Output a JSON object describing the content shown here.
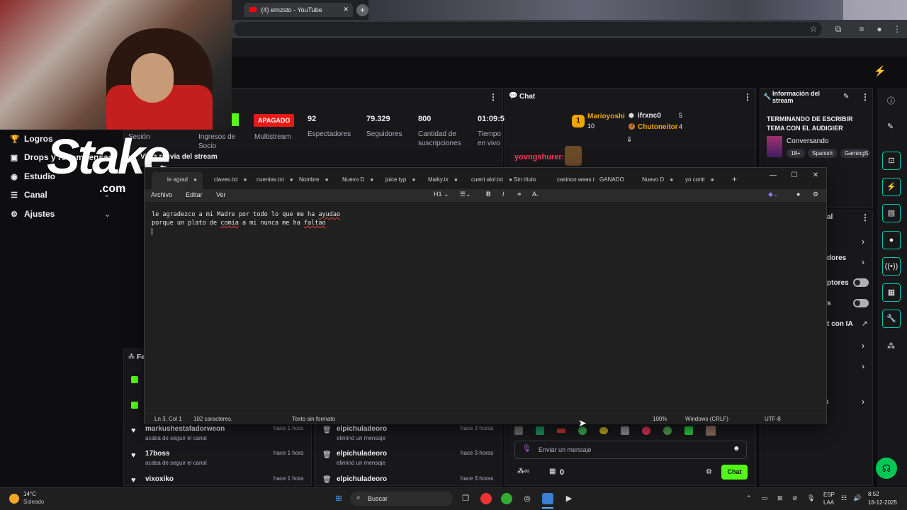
{
  "browser": {
    "tabs": [
      {
        "label": "(4) ernzsto - YouTube"
      }
    ],
    "new_tab": "+"
  },
  "nav": {
    "items": [
      {
        "label": "Logros",
        "icon": "trophy-icon"
      },
      {
        "label": "Drops y recompensas",
        "icon": "gift-icon"
      },
      {
        "label": "Estudio",
        "icon": "camera-icon"
      },
      {
        "label": "Canal",
        "icon": "list-icon"
      },
      {
        "label": "Ajustes",
        "icon": "gear-icon"
      }
    ],
    "stake": {
      "logo": "Stake",
      "suffix": ".com"
    }
  },
  "stats": {
    "cells": [
      {
        "value": "",
        "label": "Sesión"
      },
      {
        "value": "",
        "label": "Ingresos de Socio"
      },
      {
        "value": "APAGADO",
        "label": "Multistream"
      },
      {
        "value": "92",
        "label": "Espectadores"
      },
      {
        "value": "79.329",
        "label": "Seguidores"
      },
      {
        "value": "800",
        "label": "Cantidad de suscripciones"
      },
      {
        "value": "01:09:5",
        "label": "Tiempo en vivo"
      }
    ],
    "preview_title": "Vista previa del stream"
  },
  "chat": {
    "title": "Chat",
    "leaderboard": [
      {
        "rank": "1",
        "name": "Marioyoshi",
        "count": "10"
      },
      {
        "rank": "",
        "name": "ifrxnc0",
        "count": "5"
      },
      {
        "rank": "3",
        "name": "Chutoneitor",
        "count": "4"
      }
    ],
    "message_user": "yovngshurer:",
    "input_placeholder": "Enviar un mensaje",
    "points": "0",
    "send_label": "Chat"
  },
  "stream_info": {
    "title": "Información del stream",
    "stream_title": "TERMINANDO DE ESCRIBIR TEMA CON EL AUDIGIER",
    "category": "Conversando",
    "tags": [
      "18+",
      "Spanish",
      "GamingS"
    ]
  },
  "quick_actions": {
    "title": "al",
    "items": [
      {
        "label": "",
        "type": "link"
      },
      {
        "label": "dores",
        "type": "link"
      },
      {
        "label": "ptores",
        "type": "toggle"
      },
      {
        "label": "s",
        "type": "toggle"
      },
      {
        "label": "t con IA",
        "type": "external"
      },
      {
        "label": "",
        "type": "link"
      },
      {
        "label": "",
        "type": "link"
      },
      {
        "label": "s",
        "type": "link"
      }
    ]
  },
  "feed": {
    "title": "Fe",
    "left": [
      {
        "name": "markushestafadorweon",
        "sub": "acaba de seguir el canal",
        "time": "hace 1 hora"
      },
      {
        "name": "17boss",
        "sub": "acaba de seguir el canal",
        "time": "hace 1 hora"
      },
      {
        "name": "vixoxiko",
        "sub": "",
        "time": "hace 1 hora"
      }
    ],
    "right": [
      {
        "name": "elpichuladeoro",
        "sub": "eliminó un mensaje",
        "time": "hace 3 horas"
      },
      {
        "name": "elpichuladeoro",
        "sub": "eliminó un mensaje",
        "time": "hace 3 horas"
      },
      {
        "name": "elpichuladeoro",
        "sub": "",
        "time": "hace 3 horas"
      }
    ]
  },
  "notepad": {
    "tabs": [
      "le agrad",
      "claves.txt",
      "cuentas.txt",
      "Nombre",
      "Nuevo D",
      "juice typ",
      "Maiky.tx",
      "cuent alol.txt",
      "Sin título",
      "casinoo weas.t",
      "GANADO",
      "Nuevo D",
      "yo conti"
    ],
    "menu": [
      "Archivo",
      "Editar",
      "Ver"
    ],
    "heading": "H1",
    "lines": [
      {
        "before": "le agradezco a mi Madre por todo lo que me ha ",
        "misspelled": "ayudao",
        "after": ""
      },
      {
        "before": "porque un plato de ",
        "misspelled": "comia",
        "after": " a mi nunca me ha ",
        "misspelled2": "faltao"
      }
    ],
    "status": {
      "position": "Ln 3, Col 1",
      "chars": "102 caracteres.",
      "format": "Texto sin formato",
      "zoom": "100%",
      "eol": "Windows (CRLF)",
      "encoding": "UTF-8"
    }
  },
  "taskbar": {
    "weather_temp": "14°C",
    "weather_desc": "Soleado",
    "search": "Buscar",
    "lang": "ESP",
    "lang2": "LAA",
    "time": "8:52",
    "date": "18-12-2025"
  },
  "colors": {
    "accent": "#00c8af",
    "live_red": "#e91916",
    "chat_send": "#53fc18",
    "gold": "#f0a500"
  }
}
